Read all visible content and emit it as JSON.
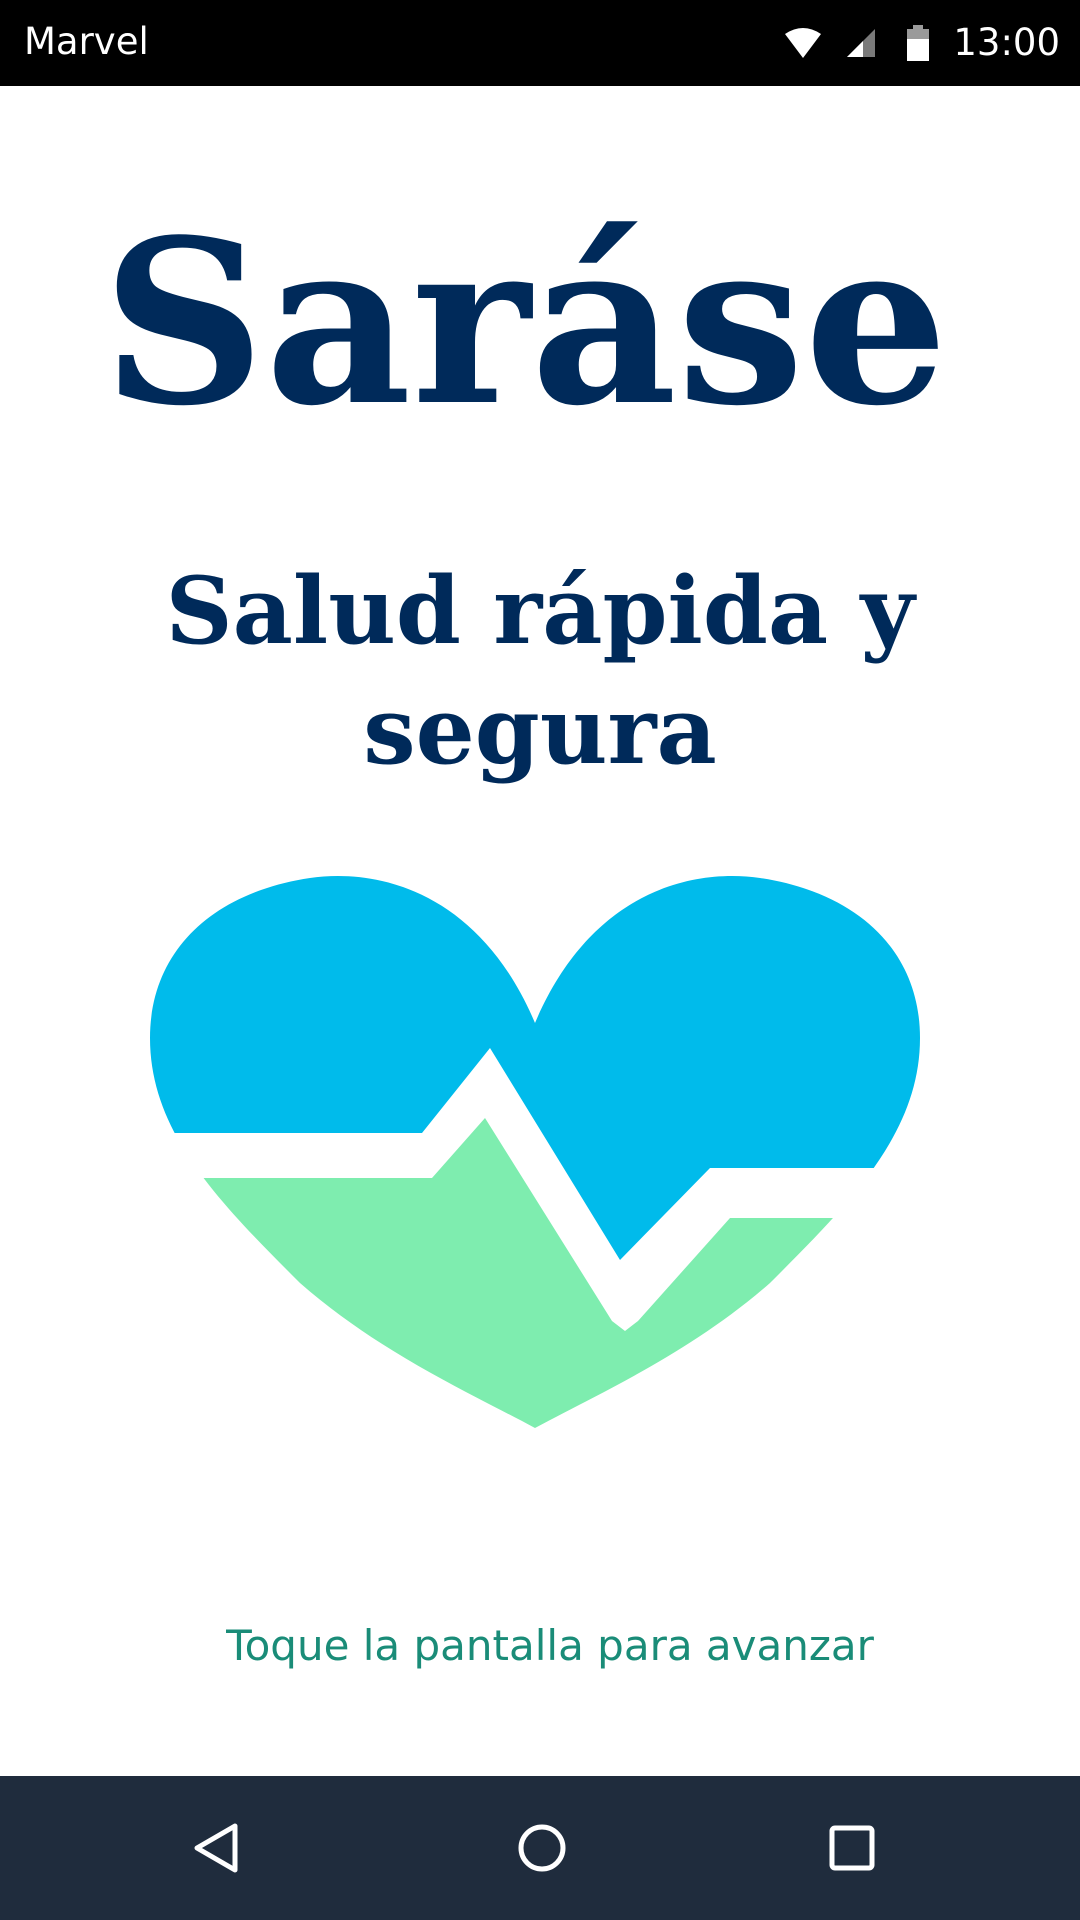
{
  "status_bar": {
    "app_name": "Marvel",
    "time": "13:00",
    "icons": [
      "wifi-icon",
      "signal-icon",
      "battery-icon"
    ]
  },
  "splash": {
    "title": "Saráse",
    "subtitle": "Salud rápida y segura",
    "logo_icon": "heart-pulse-icon",
    "hint": "Toque la pantalla para avanzar"
  },
  "nav_bar": {
    "buttons": [
      "back-icon",
      "home-icon",
      "recent-apps-icon"
    ]
  },
  "colors": {
    "status_bar_bg": "#000000",
    "title": "#002a5a",
    "heart_top": "#00bbeb",
    "heart_bottom": "#7eedaf",
    "hint": "#1a8c78",
    "nav_bar_bg": "#1f2c3d"
  }
}
